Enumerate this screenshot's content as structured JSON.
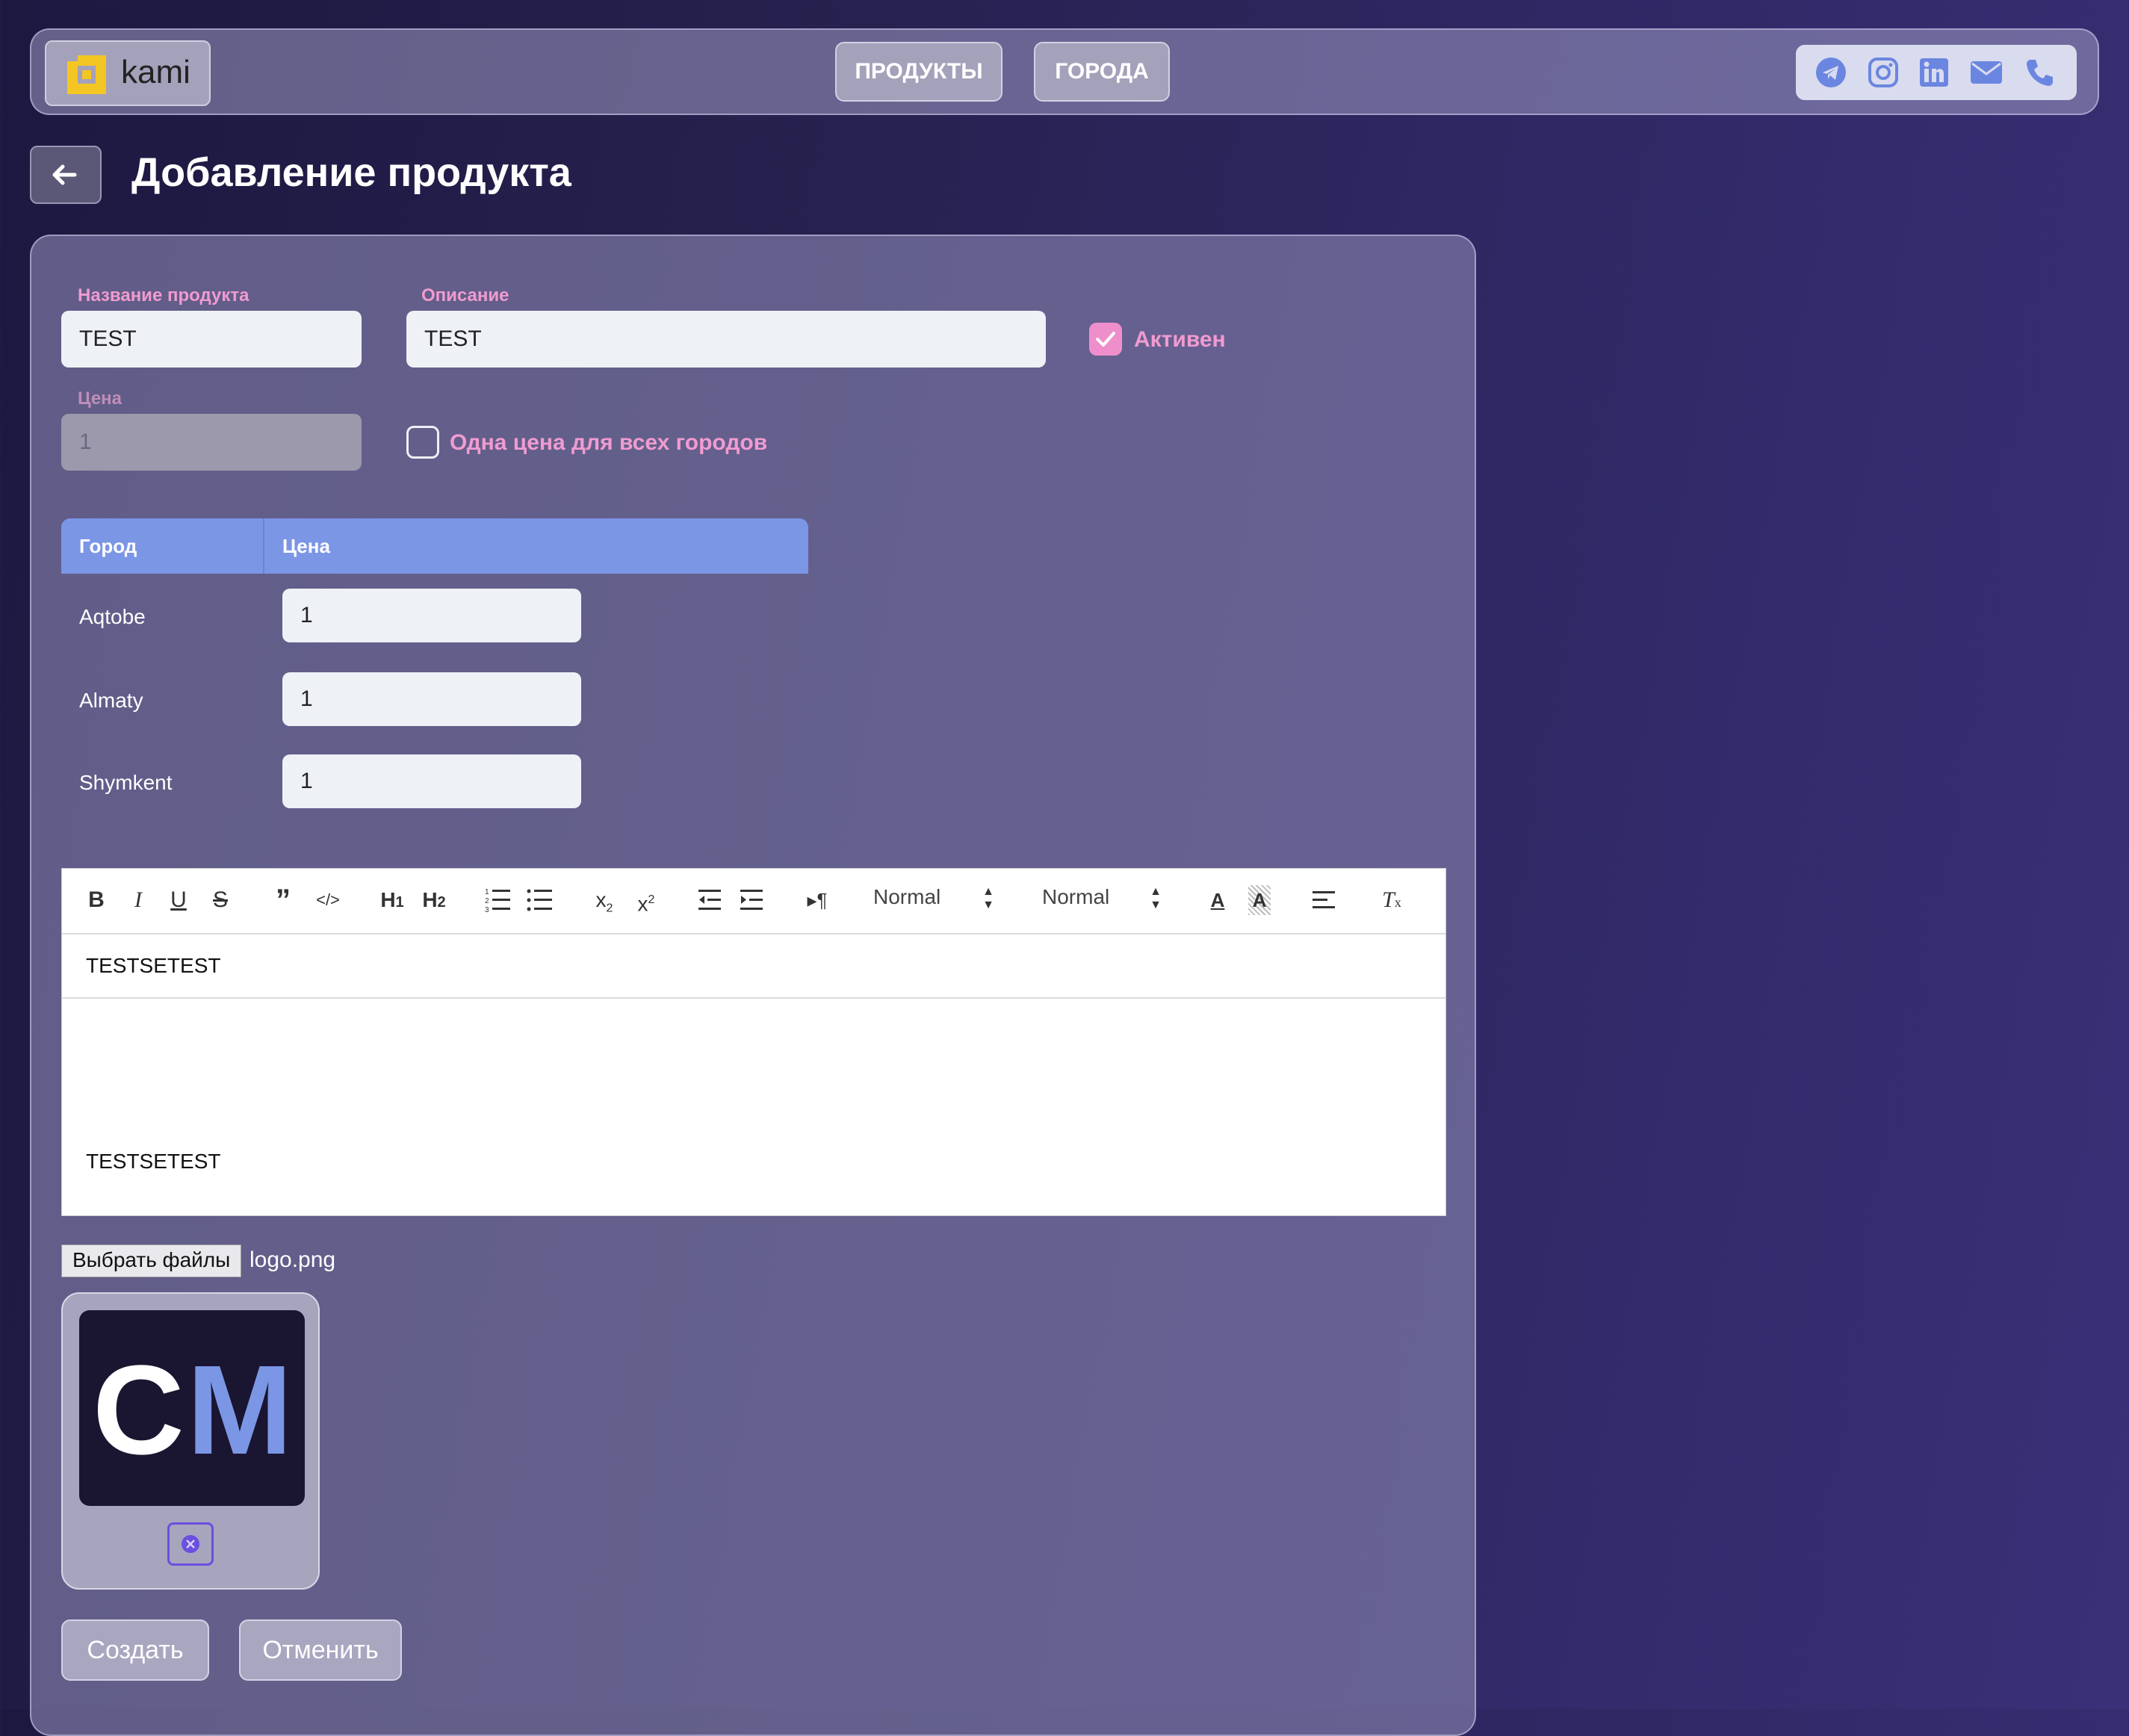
{
  "app": {
    "name": "kami"
  },
  "nav": {
    "products": "ПРОДУКТЫ",
    "cities": "ГОРОДА"
  },
  "social": {
    "icons": [
      "telegram-icon",
      "instagram-icon",
      "linkedin-icon",
      "mail-icon",
      "phone-icon"
    ],
    "accent": "#6b86e0"
  },
  "page": {
    "title": "Добавление продукта"
  },
  "form": {
    "name_label": "Название продукта",
    "name_value": "TEST",
    "desc_label": "Описание",
    "desc_value": "TEST",
    "active_label": "Активен",
    "active_checked": true,
    "price_label": "Цена",
    "price_value": "1",
    "same_price_label": "Одна цена для всех городов",
    "same_price_checked": false
  },
  "table": {
    "headers": [
      "Город",
      "Цена"
    ],
    "rows": [
      {
        "city": "Aqtobe",
        "price": "1"
      },
      {
        "city": "Almaty",
        "price": "1"
      },
      {
        "city": "Shymkent",
        "price": "1"
      }
    ]
  },
  "editor": {
    "header_select": "Normal",
    "size_select": "Normal",
    "toolbar_icons": [
      "bold-icon",
      "italic-icon",
      "underline-icon",
      "strike-icon",
      "blockquote-icon",
      "code-icon",
      "h1-icon",
      "h2-icon",
      "ordered-list-icon",
      "bullet-list-icon",
      "subscript-icon",
      "superscript-icon",
      "outdent-icon",
      "indent-icon",
      "rtl-icon",
      "text-color-icon",
      "background-color-icon",
      "align-icon",
      "clean-format-icon"
    ],
    "line1": "TESTSETEST",
    "line2": "TESTSETEST"
  },
  "upload": {
    "button": "Выбрать файлы",
    "file_name": "logo.png",
    "preview_text_1": "C",
    "preview_text_2": "M"
  },
  "actions": {
    "create": "Создать",
    "cancel": "Отменить"
  },
  "colors": {
    "pink": "#f09bd0",
    "table_header": "#7c96e6",
    "remove": "#6b4fe0"
  }
}
